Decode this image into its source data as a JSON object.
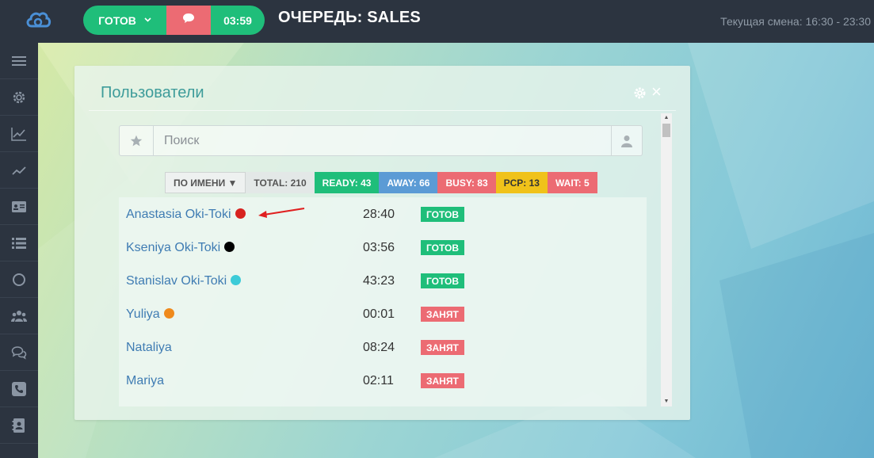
{
  "topbar": {
    "status_label": "ГОТОВ",
    "status_chevron": "⌄",
    "timer": "03:59",
    "queue_title": "ОЧЕРЕДЬ: SALES",
    "shift": "Текущая смена: 16:30 - 23:30"
  },
  "sidebar": {
    "items": [
      {
        "icon": "menu-icon"
      },
      {
        "icon": "gear-icon"
      },
      {
        "icon": "chart-line-icon"
      },
      {
        "icon": "trend-icon"
      },
      {
        "icon": "id-card-icon"
      },
      {
        "icon": "list-icon"
      },
      {
        "icon": "circle-icon"
      },
      {
        "icon": "users-icon"
      },
      {
        "icon": "chat-icon"
      },
      {
        "icon": "phone-icon"
      },
      {
        "icon": "contacts-icon"
      }
    ]
  },
  "panel": {
    "title": "Пользователи",
    "close": "×",
    "search_placeholder": "Поиск"
  },
  "stats": {
    "sort": "ПО ИМЕНИ ▼",
    "total": "TOTAL: 210",
    "ready": "READY: 43",
    "away": "AWAY: 66",
    "busy": "BUSY: 83",
    "pcp": "PCP: 13",
    "wait": "WAIT: 5"
  },
  "users": [
    {
      "name": "Anastasia Oki-Toki",
      "dot": "#d7231f",
      "time": "28:40",
      "status": "ГОТОВ",
      "status_color": "#1fbe7a"
    },
    {
      "name": "Kseniya Oki-Toki",
      "dot": "#000000",
      "time": "03:56",
      "status": "ГОТОВ",
      "status_color": "#1fbe7a"
    },
    {
      "name": "Stanislav Oki-Toki",
      "dot": "#3ccbd8",
      "time": "43:23",
      "status": "ГОТОВ",
      "status_color": "#1fbe7a"
    },
    {
      "name": "Yuliya",
      "dot": "#ef8a1c",
      "time": "00:01",
      "status": "ЗАНЯТ",
      "status_color": "#ec6b73"
    },
    {
      "name": "Nataliya",
      "dot": "",
      "time": "08:24",
      "status": "ЗАНЯТ",
      "status_color": "#ec6b73"
    },
    {
      "name": "Mariya",
      "dot": "",
      "time": "02:11",
      "status": "ЗАНЯТ",
      "status_color": "#ec6b73"
    }
  ],
  "colors": {
    "accent_green": "#1fbe7a",
    "accent_red": "#ec6b73",
    "sidebar": "#2c3440",
    "title_teal": "#3e9c9a",
    "link_blue": "#3f7cb3"
  }
}
